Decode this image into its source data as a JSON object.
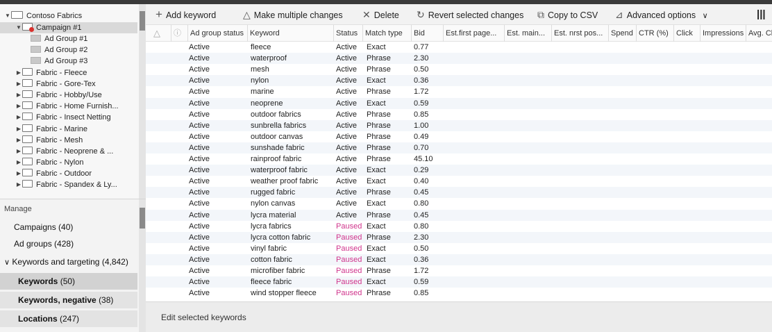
{
  "tree": {
    "account": "Contoso Fabrics",
    "campaign": "Campaign #1",
    "ad_groups": [
      "Ad Group #1",
      "Ad Group #2",
      "Ad Group #3"
    ],
    "campaigns": [
      "Fabric - Fleece",
      "Fabric - Gore-Tex",
      "Fabric - Hobby/Use",
      "Fabric - Home Furnish...",
      "Fabric - Insect Netting",
      "Fabric - Marine",
      "Fabric - Mesh",
      "Fabric - Neoprene & ...",
      "Fabric - Nylon",
      "Fabric - Outdoor",
      "Fabric - Spandex & Ly..."
    ]
  },
  "manage": {
    "title": "Manage",
    "campaigns_label": "Campaigns",
    "campaigns_count": "(40)",
    "ad_groups_label": "Ad groups",
    "ad_groups_count": "(428)",
    "keywords_targeting_label": "Keywords and targeting",
    "keywords_targeting_count": "(4,842)",
    "keywords_label": "Keywords",
    "keywords_count": "(50)",
    "negative_label": "Keywords, negative",
    "negative_count": "(38)",
    "locations_label": "Locations",
    "locations_count": "(247)"
  },
  "toolbar": {
    "add_keyword": "Add keyword",
    "multiple_changes": "Make multiple changes",
    "delete": "Delete",
    "revert": "Revert selected changes",
    "copy_csv": "Copy to CSV",
    "advanced": "Advanced options"
  },
  "grid": {
    "columns": {
      "ad_group_status": "Ad group status",
      "keyword": "Keyword",
      "status": "Status",
      "match_type": "Match type",
      "bid": "Bid",
      "est_first_page": "Est.first page...",
      "est_main": "Est. main...",
      "est_nrst": "Est. nrst pos...",
      "spend": "Spend",
      "ctr": "CTR (%)",
      "click": "Click",
      "impressions": "Impressions",
      "avg": "Avg. Cl"
    },
    "rows": [
      {
        "ag": "Active",
        "kw": "fleece",
        "st": "Active",
        "mt": "Exact",
        "bid": "0.77"
      },
      {
        "ag": "Active",
        "kw": "waterproof",
        "st": "Active",
        "mt": "Phrase",
        "bid": "2.30"
      },
      {
        "ag": "Active",
        "kw": "mesh",
        "st": "Active",
        "mt": "Phrase",
        "bid": "0.50"
      },
      {
        "ag": "Active",
        "kw": "nylon",
        "st": "Active",
        "mt": "Exact",
        "bid": "0.36"
      },
      {
        "ag": "Active",
        "kw": "marine",
        "st": "Active",
        "mt": "Phrase",
        "bid": "1.72"
      },
      {
        "ag": "Active",
        "kw": "neoprene",
        "st": "Active",
        "mt": "Exact",
        "bid": "0.59"
      },
      {
        "ag": "Active",
        "kw": "outdoor fabrics",
        "st": "Active",
        "mt": "Phrase",
        "bid": "0.85"
      },
      {
        "ag": "Active",
        "kw": "sunbrella fabrics",
        "st": "Active",
        "mt": "Phrase",
        "bid": "1.00"
      },
      {
        "ag": "Active",
        "kw": "outdoor canvas",
        "st": "Active",
        "mt": "Phrase",
        "bid": "0.49"
      },
      {
        "ag": "Active",
        "kw": "sunshade fabric",
        "st": "Active",
        "mt": "Phrase",
        "bid": "0.70"
      },
      {
        "ag": "Active",
        "kw": "rainproof fabric",
        "st": "Active",
        "mt": "Phrase",
        "bid": "45.10"
      },
      {
        "ag": "Active",
        "kw": "waterproof fabric",
        "st": "Active",
        "mt": "Exact",
        "bid": "0.29"
      },
      {
        "ag": "Active",
        "kw": "weather proof fabric",
        "st": "Active",
        "mt": "Exact",
        "bid": "0.40"
      },
      {
        "ag": "Active",
        "kw": "rugged fabric",
        "st": "Active",
        "mt": "Phrase",
        "bid": "0.45"
      },
      {
        "ag": "Active",
        "kw": "nylon canvas",
        "st": "Active",
        "mt": "Exact",
        "bid": "0.80"
      },
      {
        "ag": "Active",
        "kw": "lycra material",
        "st": "Active",
        "mt": "Phrase",
        "bid": "0.45"
      },
      {
        "ag": "Active",
        "kw": "lycra fabrics",
        "st": "Paused",
        "mt": "Exact",
        "bid": "0.80"
      },
      {
        "ag": "Active",
        "kw": "lycra cotton fabric",
        "st": "Paused",
        "mt": "Phrase",
        "bid": "2.30"
      },
      {
        "ag": "Active",
        "kw": "vinyl fabric",
        "st": "Paused",
        "mt": "Exact",
        "bid": "0.50"
      },
      {
        "ag": "Active",
        "kw": "cotton fabric",
        "st": "Paused",
        "mt": "Exact",
        "bid": "0.36"
      },
      {
        "ag": "Active",
        "kw": "microfiber fabric",
        "st": "Paused",
        "mt": "Phrase",
        "bid": "1.72"
      },
      {
        "ag": "Active",
        "kw": "fleece fabric",
        "st": "Paused",
        "mt": "Exact",
        "bid": "0.59"
      },
      {
        "ag": "Active",
        "kw": "wind stopper fleece",
        "st": "Paused",
        "mt": "Phrase",
        "bid": "0.85"
      }
    ]
  },
  "footer": {
    "edit_label": "Edit selected keywords"
  },
  "colors": {
    "paused": "#d0348c",
    "alt_row": "#f3f6fa",
    "campaign_alert": "#d9302c"
  }
}
